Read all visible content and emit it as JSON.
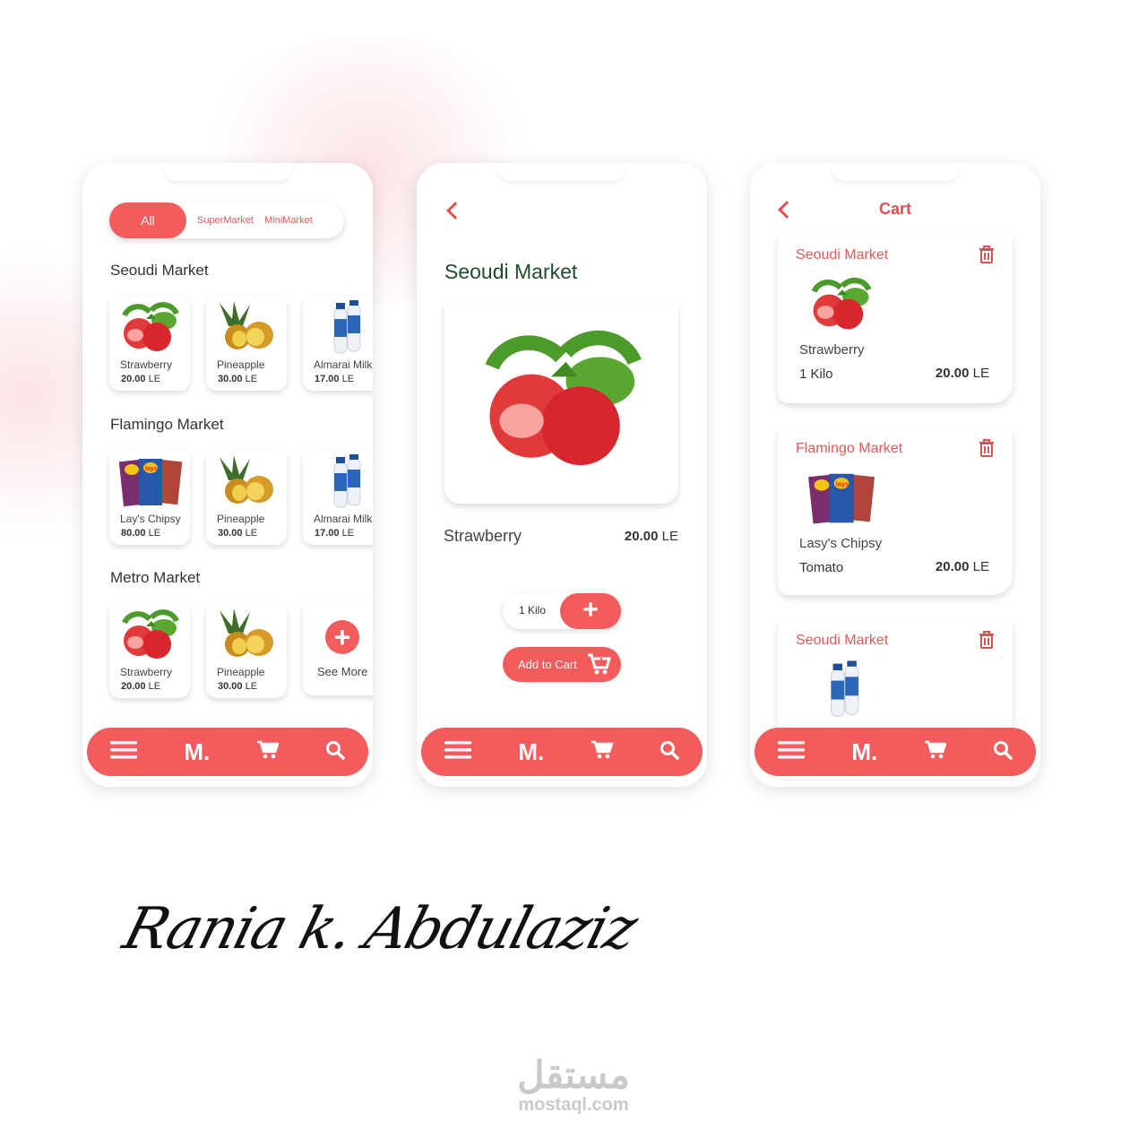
{
  "colors": {
    "accent": "#f25c5c",
    "title_green": "#1f4d2a"
  },
  "home": {
    "tabs": [
      "All",
      "SuperMarket",
      "MiniMarket"
    ],
    "sections": [
      {
        "title": "Seoudi Market",
        "items": [
          {
            "name": "Strawberry",
            "price": "20.00",
            "unit": "LE",
            "img": "strawberry"
          },
          {
            "name": "Pineapple",
            "price": "30.00",
            "unit": "LE",
            "img": "pineapple"
          },
          {
            "name": "Almarai Milk",
            "price": "17.00",
            "unit": "LE",
            "img": "milk"
          }
        ]
      },
      {
        "title": "Flamingo Market",
        "items": [
          {
            "name": "Lay's Chipsy",
            "price": "80.00",
            "unit": "LE",
            "img": "chips"
          },
          {
            "name": "Pineapple",
            "price": "30.00",
            "unit": "LE",
            "img": "pineapple"
          },
          {
            "name": "Almarai Milk",
            "price": "17.00",
            "unit": "LE",
            "img": "milk"
          }
        ]
      },
      {
        "title": "Metro Market",
        "items": [
          {
            "name": "Strawberry",
            "price": "20.00",
            "unit": "LE",
            "img": "strawberry"
          },
          {
            "name": "Pineapple",
            "price": "30.00",
            "unit": "LE",
            "img": "pineapple"
          }
        ]
      }
    ],
    "see_more": "See More"
  },
  "detail": {
    "title": "Seoudi Market",
    "product": "Strawberry",
    "price": "20.00",
    "unit": "LE",
    "qty": "1 Kilo",
    "add_to_cart": "Add to Cart"
  },
  "cart": {
    "title": "Cart",
    "items": [
      {
        "market": "Seoudi Market",
        "name": "Strawberry",
        "qty": "1 Kilo",
        "price": "20.00",
        "unit": "LE",
        "img": "strawberry"
      },
      {
        "market": "Flamingo Market",
        "name": "Lasy's Chipsy",
        "qty": "Tomato",
        "price": "20.00",
        "unit": "LE",
        "img": "chips"
      },
      {
        "market": "Seoudi Market",
        "img": "milk"
      }
    ]
  },
  "nav": {
    "logo": "M.",
    "icons": [
      "menu-icon",
      "logo",
      "cart-icon",
      "search-icon"
    ]
  },
  "signature": "Rania k. Abdulaziz",
  "watermark": {
    "arabic": "مستقل",
    "latin": "mostaql.com"
  }
}
